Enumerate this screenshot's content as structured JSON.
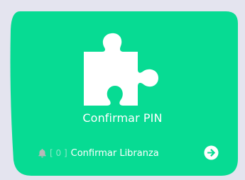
{
  "card": {
    "title": "Confirmar PIN",
    "background_color": "#07db93",
    "icon": "puzzle-piece-icon"
  },
  "footer": {
    "notification_icon": "bell-icon",
    "counter": "[ 0 ]",
    "label": "Confirmar Libranza",
    "action_icon": "arrow-right-circle-icon"
  }
}
